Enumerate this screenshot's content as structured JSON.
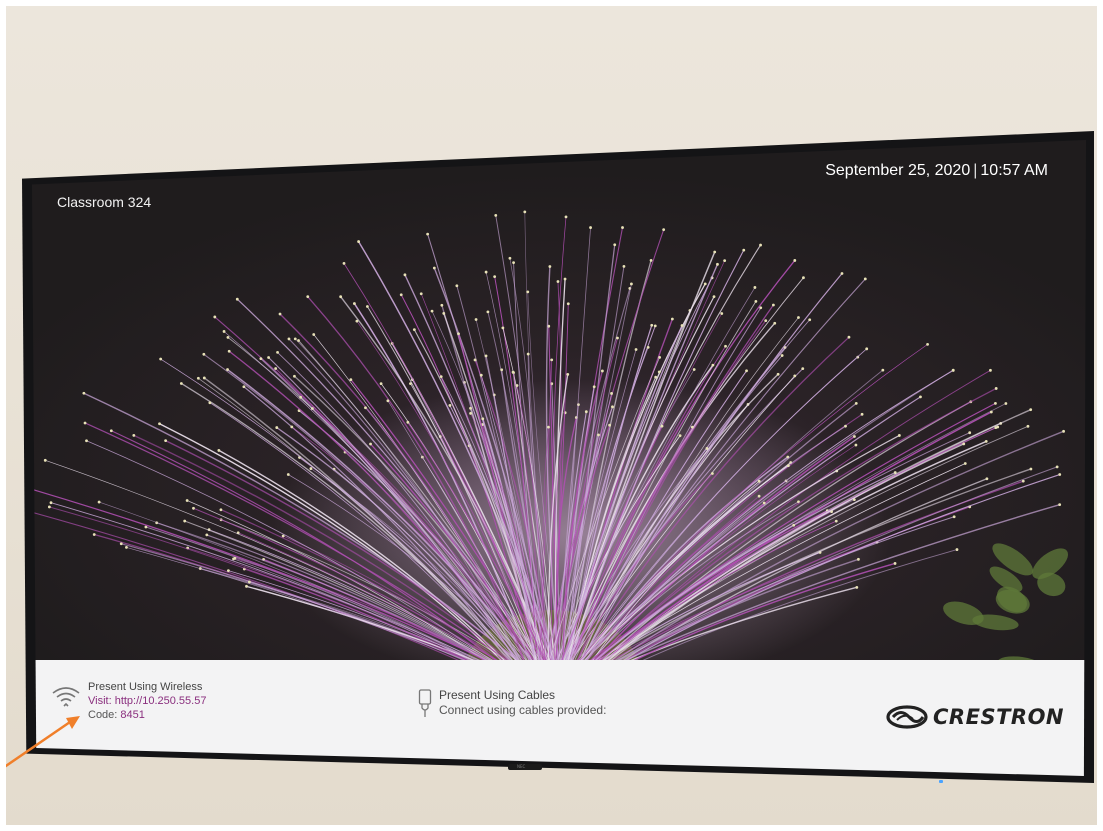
{
  "screen": {
    "room_name": "Classroom 324",
    "date": "September 25, 2020",
    "separator": "|",
    "time": "10:57 AM"
  },
  "wireless": {
    "title": "Present Using Wireless",
    "visit_label": "Visit:",
    "visit_url": "http://10.250.55.57",
    "code_label": "Code:",
    "code_value": "8451"
  },
  "cables": {
    "title": "Present Using Cables",
    "subtitle": "Connect using cables provided:"
  },
  "brand": {
    "logo_text": "CRESTRON"
  },
  "tv": {
    "brand_text": "NEC"
  },
  "colors": {
    "accent": "#8a2f7e",
    "annotation_arrow": "#f07f2a",
    "info_bar": "#f3f3f4"
  }
}
